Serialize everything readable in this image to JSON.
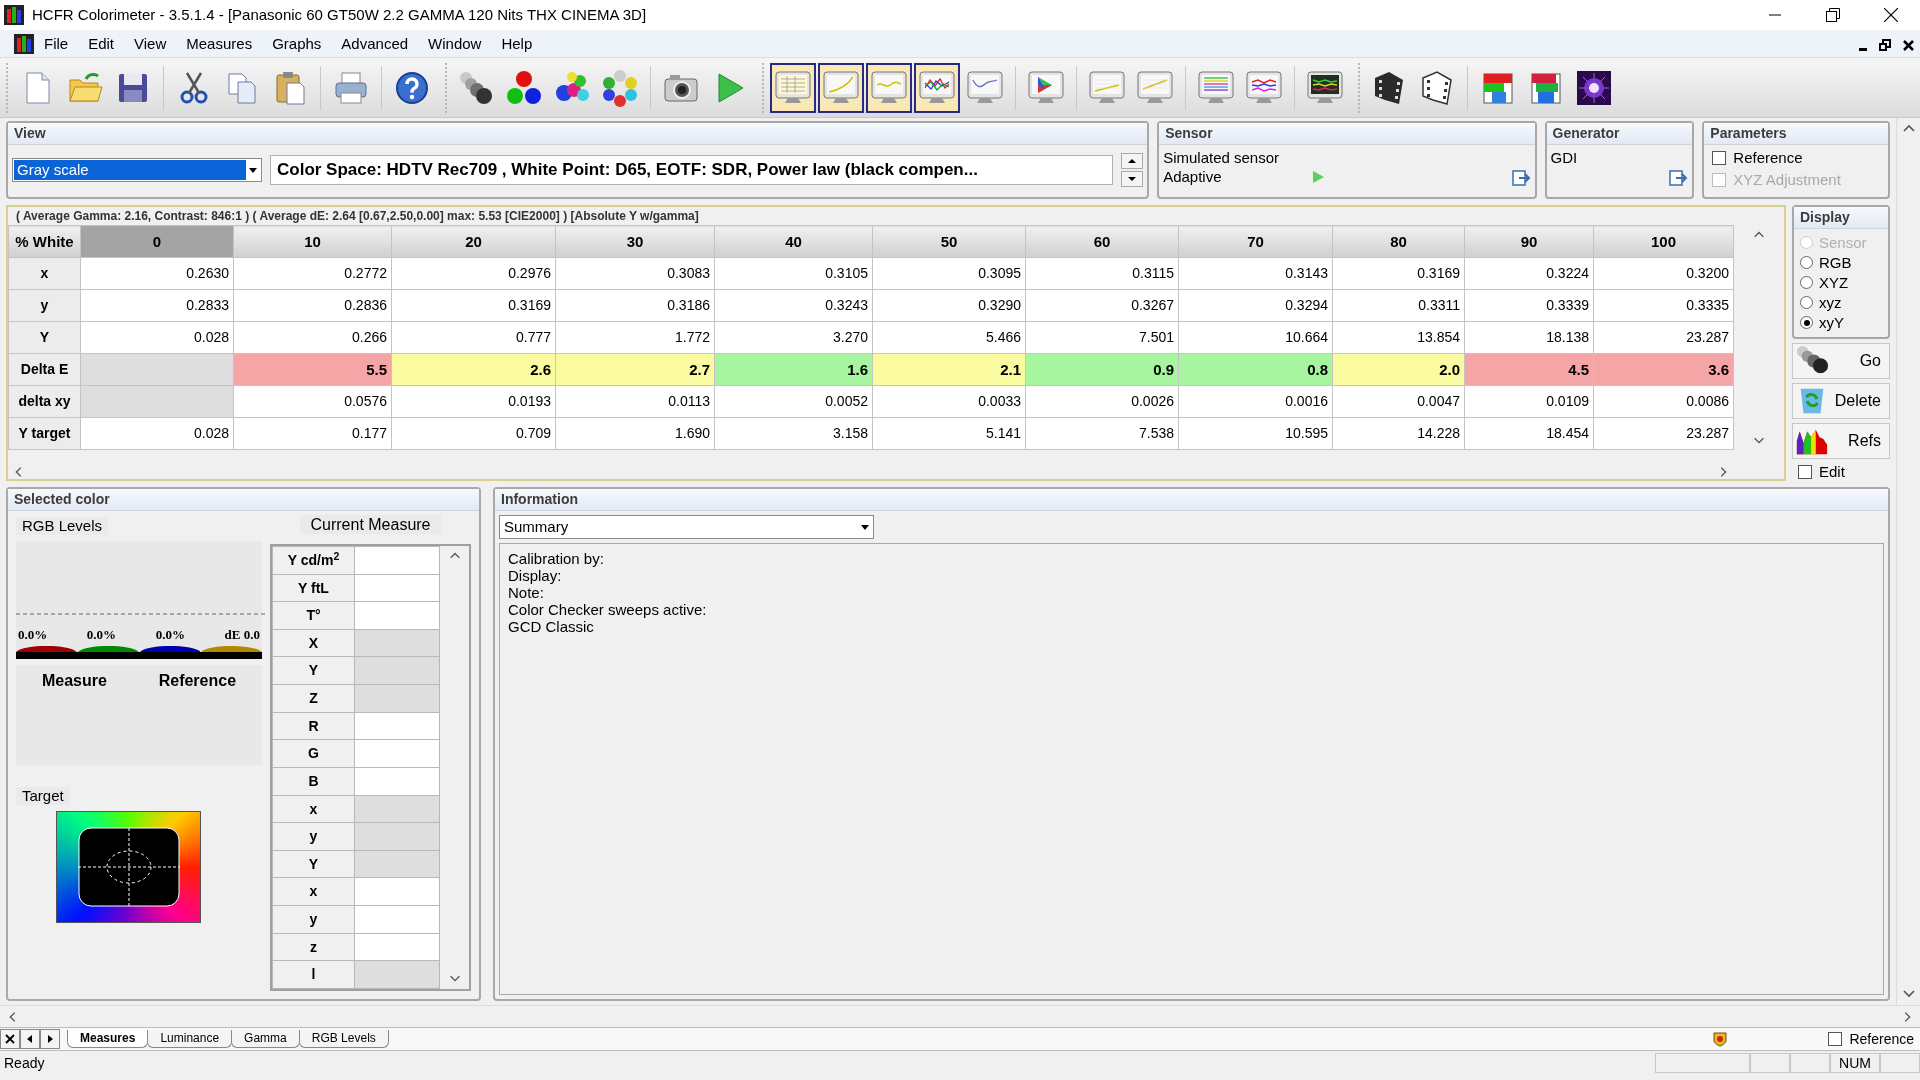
{
  "window": {
    "title": "HCFR Colorimeter - 3.5.1.4 - [Panasonic 60 GT50W 2.2 GAMMA 120 Nits THX CINEMA 3D]"
  },
  "menu": [
    "File",
    "Edit",
    "View",
    "Measures",
    "Graphs",
    "Advanced",
    "Window",
    "Help"
  ],
  "toolbar": {
    "buttons": [
      {
        "pressed": false
      },
      {
        "pressed": false
      },
      {
        "pressed": false
      },
      {
        "pressed": false
      },
      {
        "pressed": false
      },
      {
        "pressed": false
      },
      {
        "pressed": false
      },
      {
        "pressed": false
      },
      {
        "pressed": false
      },
      {
        "pressed": false
      },
      {
        "pressed": false
      },
      {
        "pressed": false
      },
      {
        "pressed": false
      },
      {
        "pressed": false
      },
      {
        "pressed": true
      },
      {
        "pressed": true
      },
      {
        "pressed": true
      },
      {
        "pressed": true
      },
      {
        "pressed": false
      },
      {
        "pressed": false
      },
      {
        "pressed": false
      },
      {
        "pressed": false
      },
      {
        "pressed": false
      },
      {
        "pressed": false
      },
      {
        "pressed": false
      },
      {
        "pressed": false
      },
      {
        "pressed": false
      },
      {
        "pressed": false
      },
      {
        "pressed": false
      },
      {
        "pressed": false
      }
    ]
  },
  "view": {
    "title": "View",
    "mode": {
      "value": "Gray scale",
      "highlighted": true
    },
    "description": "Color Space: HDTV Rec709 , White Point: D65, EOTF:  SDR, Power law (black compen..."
  },
  "sensor": {
    "title": "Sensor",
    "name": "Simulated sensor",
    "mode": "Adaptive"
  },
  "generator": {
    "title": "Generator",
    "name": "GDI"
  },
  "parameters": {
    "title": "Parameters",
    "options": [
      {
        "label": "Reference",
        "checked": false,
        "disabled": false
      },
      {
        "label": "XYZ Adjustment",
        "checked": false,
        "disabled": true
      }
    ]
  },
  "measures": {
    "summary": "( Average Gamma: 2.16, Contrast: 846:1 ) ( Average dE: 2.64 [0.67,2.50,0.00] max: 5.53 [CIE2000] ) [Absolute Y w/gamma]",
    "corner": "% White",
    "columns": [
      {
        "label": "0",
        "selected": true
      },
      {
        "label": "10",
        "selected": false
      },
      {
        "label": "20",
        "selected": false
      },
      {
        "label": "30",
        "selected": false
      },
      {
        "label": "40",
        "selected": false
      },
      {
        "label": "50",
        "selected": false
      },
      {
        "label": "60",
        "selected": false
      },
      {
        "label": "70",
        "selected": false
      },
      {
        "label": "80",
        "selected": false
      },
      {
        "label": "90",
        "selected": false
      },
      {
        "label": "100",
        "selected": false
      }
    ],
    "rows": [
      {
        "label": "x",
        "kind": "plain",
        "cells": [
          "0.2630",
          "0.2772",
          "0.2976",
          "0.3083",
          "0.3105",
          "0.3095",
          "0.3115",
          "0.3143",
          "0.3169",
          "0.3224",
          "0.3200"
        ]
      },
      {
        "label": "y",
        "kind": "plain",
        "cells": [
          "0.2833",
          "0.2836",
          "0.3169",
          "0.3186",
          "0.3243",
          "0.3290",
          "0.3267",
          "0.3294",
          "0.3311",
          "0.3339",
          "0.3335"
        ]
      },
      {
        "label": "Y",
        "kind": "plain",
        "cells": [
          "0.028",
          "0.266",
          "0.777",
          "1.772",
          "3.270",
          "5.466",
          "7.501",
          "10.664",
          "13.854",
          "18.138",
          "23.287"
        ]
      },
      {
        "label": "Delta E",
        "kind": "graded",
        "cells": [
          null,
          {
            "value": "5.5",
            "color": "#f5a5a5"
          },
          {
            "value": "2.6",
            "color": "#fafaa0"
          },
          {
            "value": "2.7",
            "color": "#fafaa0"
          },
          {
            "value": "1.6",
            "color": "#a8f5a0"
          },
          {
            "value": "2.1",
            "color": "#fafaa0"
          },
          {
            "value": "0.9",
            "color": "#a8f5a0"
          },
          {
            "value": "0.8",
            "color": "#a8f5a0"
          },
          {
            "value": "2.0",
            "color": "#fafaa0"
          },
          {
            "value": "4.5",
            "color": "#f5a5a5"
          },
          {
            "value": "3.6",
            "color": "#f5a5a5"
          }
        ]
      },
      {
        "label": "delta xy",
        "kind": "plain",
        "cells": [
          null,
          "0.0576",
          "0.0193",
          "0.0113",
          "0.0052",
          "0.0033",
          "0.0026",
          "0.0016",
          "0.0047",
          "0.0109",
          "0.0086"
        ]
      },
      {
        "label": "Y target",
        "kind": "plain",
        "cells": [
          "0.028",
          "0.177",
          "0.709",
          "1.690",
          "3.158",
          "5.141",
          "7.538",
          "10.595",
          "14.228",
          "18.454",
          "23.287"
        ]
      }
    ]
  },
  "display": {
    "title": "Display",
    "options": [
      {
        "label": "Sensor",
        "selected": false,
        "disabled": true
      },
      {
        "label": "RGB",
        "selected": false,
        "disabled": false
      },
      {
        "label": "XYZ",
        "selected": false,
        "disabled": false
      },
      {
        "label": "xyz",
        "selected": false,
        "disabled": false
      },
      {
        "label": "xyY",
        "selected": true,
        "disabled": false
      }
    ],
    "actions": [
      "Go",
      "Delete",
      "Refs"
    ],
    "edit": {
      "label": "Edit",
      "checked": false
    }
  },
  "selected_color": {
    "title": "Selected color",
    "rgb_levels": "RGB Levels",
    "readings": [
      {
        "text": "0.0%",
        "color": "#a00000"
      },
      {
        "text": "0.0%",
        "color": "#008a00"
      },
      {
        "text": "0.0%",
        "color": "#0000b0"
      },
      {
        "text": "dE 0.0",
        "color": "#b08a00"
      }
    ],
    "measure_label": "Measure",
    "reference_label": "Reference",
    "target_label": "Target",
    "current_measure": {
      "title": "Current Measure",
      "rows": [
        {
          "label": "Y cd/m$^{2}$",
          "shaded": false
        },
        {
          "label": "Y ftL",
          "shaded": false
        },
        {
          "label": "T°",
          "shaded": false
        },
        {
          "label": "X",
          "shaded": true
        },
        {
          "label": "Y",
          "shaded": true
        },
        {
          "label": "Z",
          "shaded": true
        },
        {
          "label": "R",
          "shaded": false
        },
        {
          "label": "G",
          "shaded": false
        },
        {
          "label": "B",
          "shaded": false
        },
        {
          "label": "x",
          "shaded": true
        },
        {
          "label": "y",
          "shaded": true
        },
        {
          "label": "Y",
          "shaded": true
        },
        {
          "label": "x",
          "shaded": false
        },
        {
          "label": "y",
          "shaded": false
        },
        {
          "label": "z",
          "shaded": false
        },
        {
          "label": "l",
          "shaded": true
        }
      ]
    }
  },
  "information": {
    "title": "Information",
    "mode": "Summary",
    "lines": [
      "Calibration by:",
      "Display:",
      "Note:",
      "Color Checker sweeps active:",
      "GCD Classic"
    ]
  },
  "tabs": [
    {
      "label": "Measures",
      "selected": true
    },
    {
      "label": "Luminance",
      "selected": false
    },
    {
      "label": "Gamma",
      "selected": false
    },
    {
      "label": "RGB Levels",
      "selected": false
    }
  ],
  "tab_bar_reference": {
    "label": "Reference",
    "checked": false
  },
  "status_bar": {
    "text": "Ready",
    "indicators": [
      "NUM"
    ]
  }
}
